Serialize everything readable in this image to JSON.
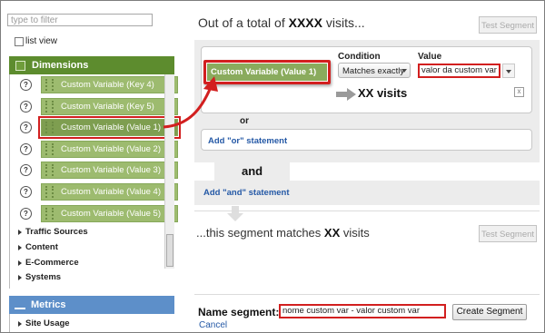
{
  "left": {
    "filter_placeholder": "type to filter",
    "list_view_label": "list view",
    "dimensions_title": "Dimensions",
    "dimension_items": [
      {
        "label": "Custom Variable (Key 4)"
      },
      {
        "label": "Custom Variable (Key 5)"
      },
      {
        "label": "Custom Variable (Value 1)"
      },
      {
        "label": "Custom Variable (Value 2)"
      },
      {
        "label": "Custom Variable (Value 3)"
      },
      {
        "label": "Custom Variable (Value 4)"
      },
      {
        "label": "Custom Variable (Value 5)"
      }
    ],
    "help_mark": "?",
    "categories": [
      "Traffic Sources",
      "Content",
      "E-Commerce",
      "Systems"
    ],
    "metrics_title": "Metrics",
    "metrics_items": [
      "Site Usage"
    ]
  },
  "main": {
    "title_prefix": "Out of a total of",
    "title_value": "XXXX",
    "title_suffix": "visits...",
    "test_segment_label": "Test Segment",
    "condition_label": "Condition",
    "value_label": "Value",
    "dimension_chip": "Custom Variable (Value 1)",
    "condition_selected": "Matches exactly",
    "value_input": "valor da custom var",
    "result_visits": "XX visits",
    "remove_mark": "x",
    "or_label": "or",
    "add_or_label": "Add \"or\" statement",
    "and_label": "and",
    "add_and_label": "Add \"and\" statement",
    "matches_prefix": "...this segment matches",
    "matches_value": "XX",
    "matches_suffix": "visits",
    "name_segment_label": "Name segment:",
    "name_segment_value": "nome custom var - valor custom var",
    "create_segment_label": "Create Segment",
    "cancel_label": "Cancel"
  },
  "colors": {
    "dimension_green": "#5d8c2e",
    "chip_green": "#9dbb6f",
    "metrics_blue": "#5d8fc9",
    "highlight_red": "#d21f1f",
    "link_blue": "#2559a6"
  }
}
